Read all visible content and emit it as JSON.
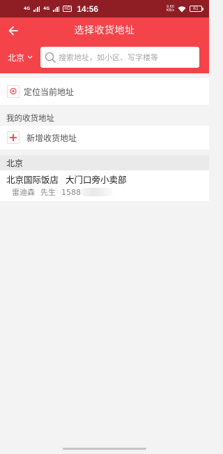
{
  "status_bar": {
    "net1": "4G",
    "net2": "4G",
    "hd_badge": "HD",
    "time": "14:56",
    "speed_value": "9.60",
    "speed_unit": "KB/s",
    "battery": "61"
  },
  "header": {
    "title": "选择收货地址",
    "city": "北京",
    "search_placeholder": "搜索地址，如小区、写字楼等"
  },
  "locate": {
    "label": "定位当前地址"
  },
  "my_addresses": {
    "section_title": "我的收货地址",
    "add_label": "新增收货地址"
  },
  "groups": [
    {
      "city": "北京",
      "items": [
        {
          "place": "北京国际饭店",
          "detail": "大门口旁小卖部",
          "name": "雷迪森",
          "title": "先生",
          "phone": "1588"
        }
      ]
    }
  ],
  "colors": {
    "status_bar": "#8f1e24",
    "header": "#f4444a",
    "accent": "#f4444a",
    "background": "#f2f3f2"
  }
}
